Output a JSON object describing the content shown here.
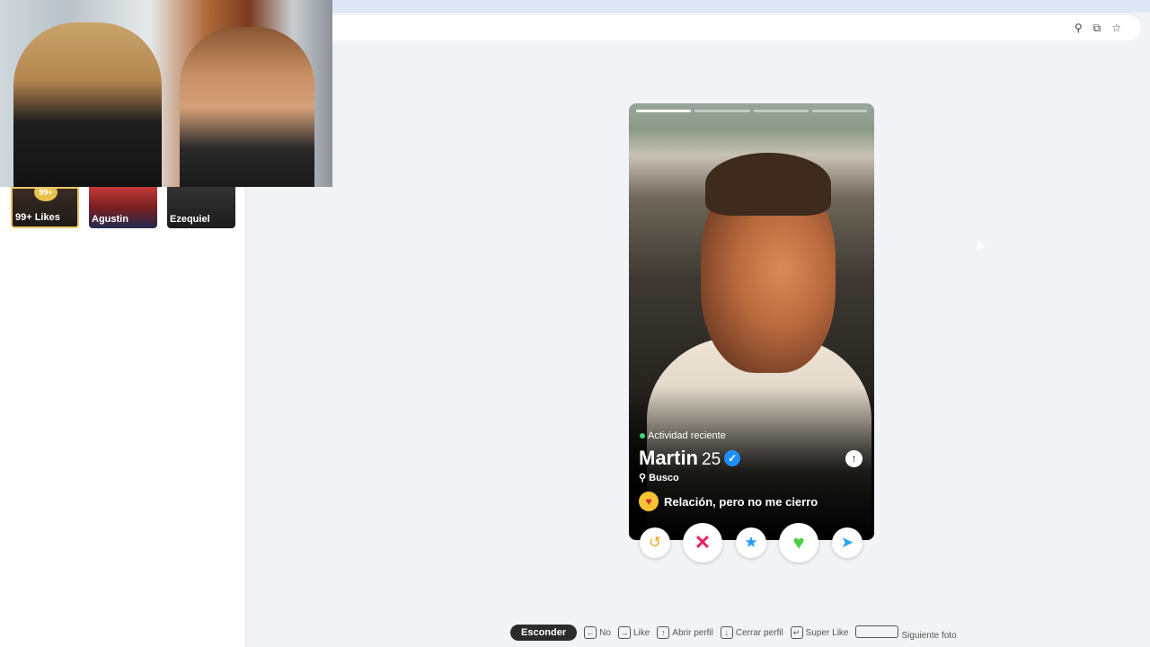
{
  "sidebar": {
    "matches": [
      {
        "label": "99+ Likes",
        "badge": "99+"
      },
      {
        "label": "Agustin"
      },
      {
        "label": "Ezequiel"
      }
    ]
  },
  "browser": {
    "icons": [
      "location-icon",
      "install-icon",
      "bookmark-star-icon"
    ]
  },
  "profile": {
    "photo_count": 4,
    "current_photo": 1,
    "activity": "Actividad reciente",
    "name": "Martin",
    "age": "25",
    "looking_label": "Busco",
    "goal": "Relación, pero no me cierro",
    "colors": {
      "activity_dot": "#3fd67a",
      "verified": "#1f8fff"
    }
  },
  "actions": {
    "rewind": "rewind-icon",
    "nope": "nope-icon",
    "superlike": "star-icon",
    "like": "heart-icon",
    "boost": "send-icon",
    "colors": {
      "rewind": "#f2a531",
      "nope": "#e91e63",
      "superlike": "#1c9cf6",
      "like": "#4ccf43",
      "boost": "#2aa3ef"
    }
  },
  "shortcuts": {
    "hide": "Esconder",
    "no": "No",
    "like": "Like",
    "open_profile": "Abrir perfil",
    "close_profile": "Cerrar perfil",
    "super_like": "Super Like",
    "next_photo": "Siguiente foto"
  }
}
